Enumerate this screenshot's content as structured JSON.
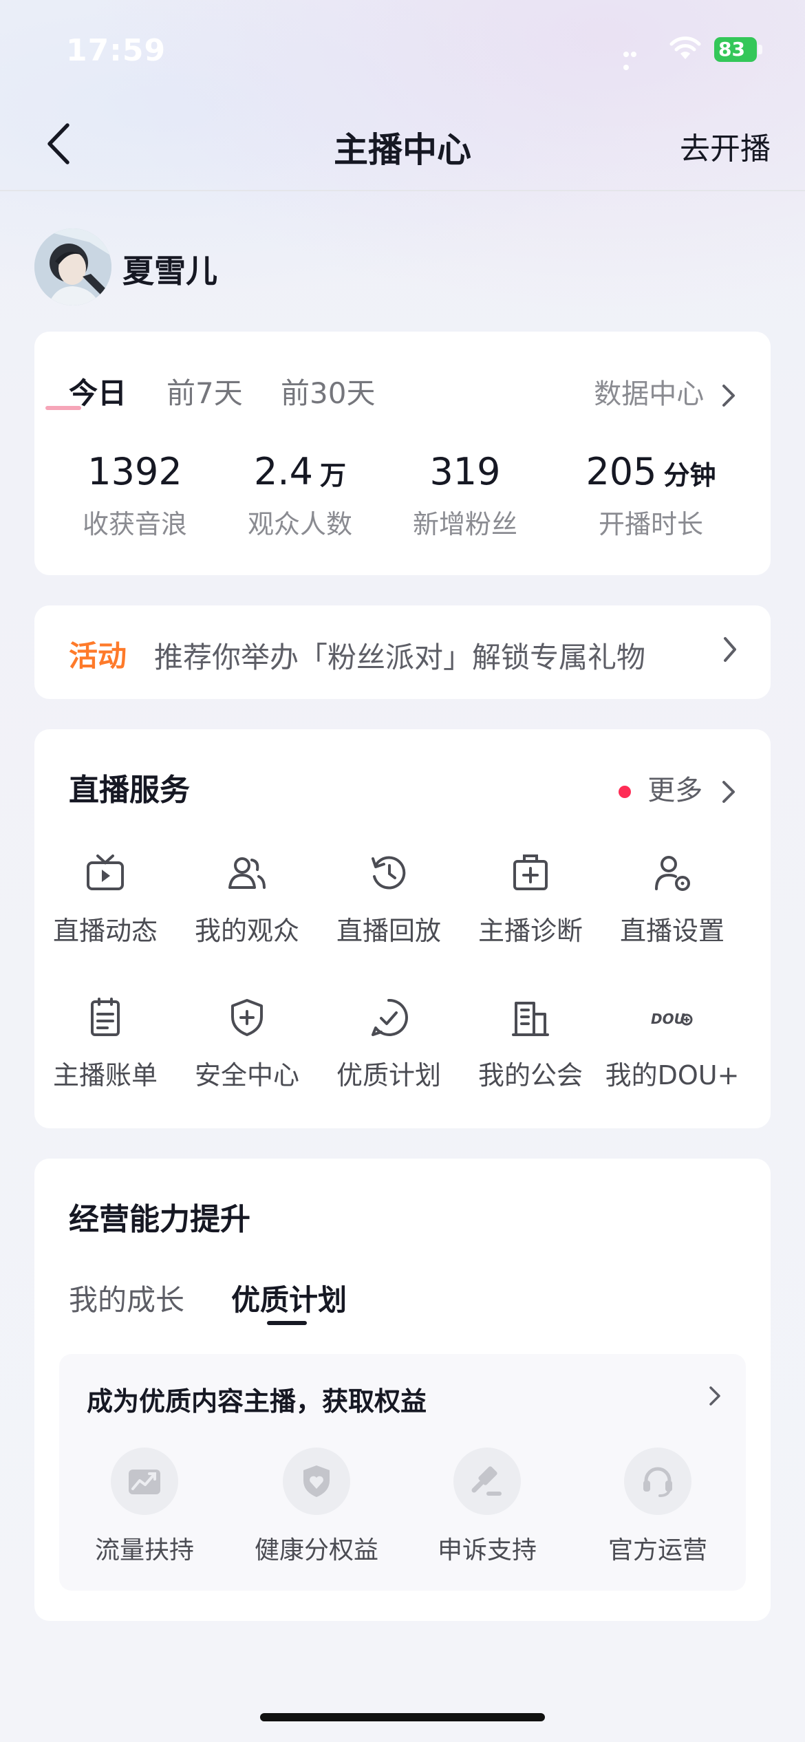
{
  "status_bar": {
    "time": "17:59",
    "battery": "83"
  },
  "nav": {
    "title": "主播中心",
    "go_live": "去开播"
  },
  "profile": {
    "name": "夏雪儿"
  },
  "stats": {
    "tabs": [
      "今日",
      "前7天",
      "前30天"
    ],
    "active_tab": "今日",
    "data_center": "数据中心",
    "items": [
      {
        "value": "1392",
        "unit": "",
        "label": "收获音浪"
      },
      {
        "value": "2.4",
        "unit": "万",
        "label": "观众人数"
      },
      {
        "value": "319",
        "unit": "",
        "label": "新增粉丝"
      },
      {
        "value": "205",
        "unit": "分钟",
        "label": "开播时长"
      }
    ]
  },
  "activity": {
    "tag": "活动",
    "text": "推荐你举办「粉丝派对」解锁专属礼物"
  },
  "live_services": {
    "title": "直播服务",
    "more": "更多",
    "items": [
      {
        "label": "直播动态",
        "icon": "tv-play-icon"
      },
      {
        "label": "我的观众",
        "icon": "audience-icon"
      },
      {
        "label": "直播回放",
        "icon": "replay-icon"
      },
      {
        "label": "主播诊断",
        "icon": "medical-kit-icon"
      },
      {
        "label": "直播设置",
        "icon": "user-settings-icon"
      },
      {
        "label": "主播账单",
        "icon": "bill-icon"
      },
      {
        "label": "安全中心",
        "icon": "shield-icon"
      },
      {
        "label": "优质计划",
        "icon": "check-circle-icon"
      },
      {
        "label": "我的公会",
        "icon": "building-icon"
      },
      {
        "label": "我的DOU+",
        "icon": "dou-plus-icon"
      }
    ]
  },
  "business": {
    "title": "经营能力提升",
    "tabs": [
      "我的成长",
      "优质计划"
    ],
    "active_tab": "优质计划",
    "inner_title": "成为优质内容主播，获取权益",
    "benefits": [
      {
        "label": "流量扶持",
        "icon": "traffic-chart-icon"
      },
      {
        "label": "健康分权益",
        "icon": "shield-heart-icon"
      },
      {
        "label": "申诉支持",
        "icon": "gavel-icon"
      },
      {
        "label": "官方运营",
        "icon": "headset-icon"
      }
    ]
  }
}
